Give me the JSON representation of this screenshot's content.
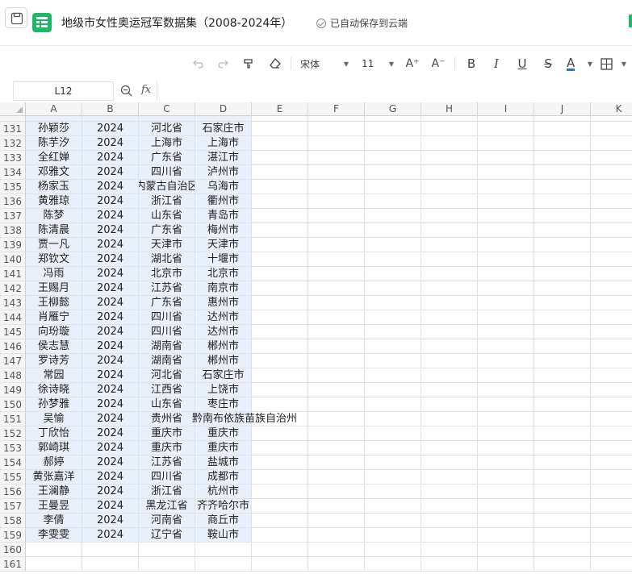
{
  "title_bar": {
    "document_title": "地级市女性奥运冠军数据集（2008-2024年）",
    "save_status": "已自动保存到云端"
  },
  "toolbar": {
    "font_name": "宋体",
    "font_size": "11",
    "buttons": [
      "undo-icon",
      "redo-icon",
      "format-painter-icon",
      "clear-format-icon",
      "font-size-increase-icon",
      "font-size-decrease-icon",
      "bold-icon",
      "italic-icon",
      "underline-icon",
      "strikethrough-icon",
      "font-color-icon",
      "borders-icon"
    ],
    "increase_label": "A⁺",
    "decrease_label": "A⁻",
    "bold_label": "B",
    "italic_label": "I",
    "underline_label": "U",
    "strike_label": "S",
    "color_label": "A",
    "font_color": "#2b6fd6"
  },
  "formula_bar": {
    "cell_ref": "L12",
    "fx_label": "fx",
    "formula": ""
  },
  "grid": {
    "columns": [
      "A",
      "B",
      "C",
      "D",
      "E",
      "F",
      "G",
      "H",
      "I",
      "J",
      "K"
    ],
    "band_color": "#e8f0fb",
    "rows": [
      {
        "n": "131",
        "a": "孙颖莎",
        "b": "2024",
        "c": "河北省",
        "d": "石家庄市"
      },
      {
        "n": "132",
        "a": "陈芋汐",
        "b": "2024",
        "c": "上海市",
        "d": "上海市"
      },
      {
        "n": "133",
        "a": "全红婵",
        "b": "2024",
        "c": "广东省",
        "d": "湛江市"
      },
      {
        "n": "134",
        "a": "邓雅文",
        "b": "2024",
        "c": "四川省",
        "d": "泸州市"
      },
      {
        "n": "135",
        "a": "杨家玉",
        "b": "2024",
        "c": "内蒙古自治区",
        "d": "乌海市"
      },
      {
        "n": "136",
        "a": "黄雅琼",
        "b": "2024",
        "c": "浙江省",
        "d": "衢州市"
      },
      {
        "n": "137",
        "a": "陈梦",
        "b": "2024",
        "c": "山东省",
        "d": "青岛市"
      },
      {
        "n": "138",
        "a": "陈清晨",
        "b": "2024",
        "c": "广东省",
        "d": "梅州市"
      },
      {
        "n": "139",
        "a": "贾一凡",
        "b": "2024",
        "c": "天津市",
        "d": "天津市"
      },
      {
        "n": "140",
        "a": "郑钦文",
        "b": "2024",
        "c": "湖北省",
        "d": "十堰市"
      },
      {
        "n": "141",
        "a": "冯雨",
        "b": "2024",
        "c": "北京市",
        "d": "北京市"
      },
      {
        "n": "142",
        "a": "王赐月",
        "b": "2024",
        "c": "江苏省",
        "d": "南京市"
      },
      {
        "n": "143",
        "a": "王柳懿",
        "b": "2024",
        "c": "广东省",
        "d": "惠州市"
      },
      {
        "n": "144",
        "a": "肖雁宁",
        "b": "2024",
        "c": "四川省",
        "d": "达州市"
      },
      {
        "n": "145",
        "a": "向玢璇",
        "b": "2024",
        "c": "四川省",
        "d": "达州市"
      },
      {
        "n": "146",
        "a": "侯志慧",
        "b": "2024",
        "c": "湖南省",
        "d": "郴州市"
      },
      {
        "n": "147",
        "a": "罗诗芳",
        "b": "2024",
        "c": "湖南省",
        "d": "郴州市"
      },
      {
        "n": "148",
        "a": "常园",
        "b": "2024",
        "c": "河北省",
        "d": "石家庄市"
      },
      {
        "n": "149",
        "a": "徐诗晓",
        "b": "2024",
        "c": "江西省",
        "d": "上饶市"
      },
      {
        "n": "150",
        "a": "孙梦雅",
        "b": "2024",
        "c": "山东省",
        "d": "枣庄市"
      },
      {
        "n": "151",
        "a": "吴愉",
        "b": "2024",
        "c": "贵州省",
        "d": "黔南布依族苗族自治州"
      },
      {
        "n": "152",
        "a": "丁欣怡",
        "b": "2024",
        "c": "重庆市",
        "d": "重庆市"
      },
      {
        "n": "153",
        "a": "郭崎琪",
        "b": "2024",
        "c": "重庆市",
        "d": "重庆市"
      },
      {
        "n": "154",
        "a": "郝婷",
        "b": "2024",
        "c": "江苏省",
        "d": "盐城市"
      },
      {
        "n": "155",
        "a": "黄张嘉洋",
        "b": "2024",
        "c": "四川省",
        "d": "成都市"
      },
      {
        "n": "156",
        "a": "王澜静",
        "b": "2024",
        "c": "浙江省",
        "d": "杭州市"
      },
      {
        "n": "157",
        "a": "王曼昱",
        "b": "2024",
        "c": "黑龙江省",
        "d": "齐齐哈尔市"
      },
      {
        "n": "158",
        "a": "李倩",
        "b": "2024",
        "c": "河南省",
        "d": "商丘市"
      },
      {
        "n": "159",
        "a": "李雯雯",
        "b": "2024",
        "c": "辽宁省",
        "d": "鞍山市"
      },
      {
        "n": "160",
        "a": "",
        "b": "",
        "c": "",
        "d": ""
      },
      {
        "n": "161",
        "a": "",
        "b": "",
        "c": "",
        "d": ""
      }
    ]
  }
}
